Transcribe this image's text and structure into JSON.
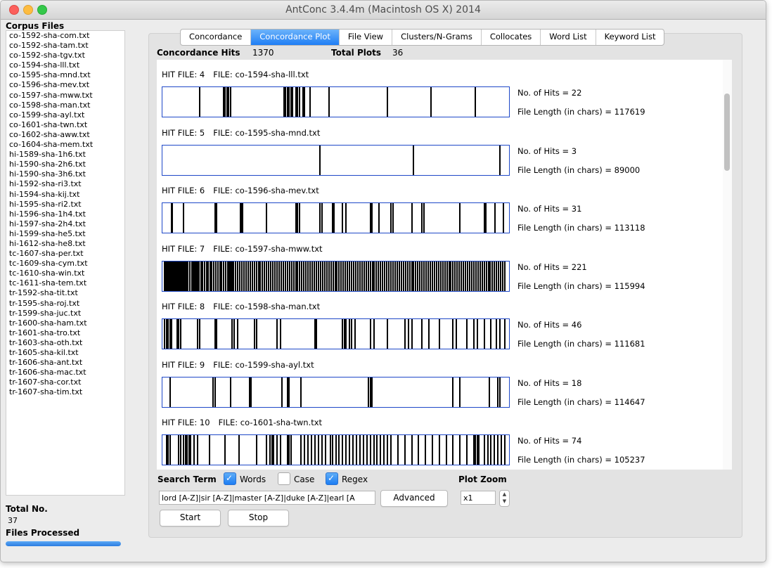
{
  "window": {
    "title": "AntConc 3.4.4m (Macintosh OS X) 2014"
  },
  "sidebar": {
    "title": "Corpus Files",
    "files": [
      "co-1592-sha-com.txt",
      "co-1592-sha-tam.txt",
      "co-1592-sha-tgv.txt",
      "co-1594-sha-lll.txt",
      "co-1595-sha-mnd.txt",
      "co-1596-sha-mev.txt",
      "co-1597-sha-mww.txt",
      "co-1598-sha-man.txt",
      "co-1599-sha-ayl.txt",
      "co-1601-sha-twn.txt",
      "co-1602-sha-aww.txt",
      "co-1604-sha-mem.txt",
      "hi-1589-sha-1h6.txt",
      "hi-1590-sha-2h6.txt",
      "hi-1590-sha-3h6.txt",
      "hi-1592-sha-ri3.txt",
      "hi-1594-sha-kij.txt",
      "hi-1595-sha-ri2.txt",
      "hi-1596-sha-1h4.txt",
      "hi-1597-sha-2h4.txt",
      "hi-1599-sha-he5.txt",
      "hi-1612-sha-he8.txt",
      "tc-1607-sha-per.txt",
      "tc-1609-sha-cym.txt",
      "tc-1610-sha-win.txt",
      "tc-1611-sha-tem.txt",
      "tr-1592-sha-tit.txt",
      "tr-1595-sha-roj.txt",
      "tr-1599-sha-juc.txt",
      "tr-1600-sha-ham.txt",
      "tr-1601-sha-tro.txt",
      "tr-1603-sha-oth.txt",
      "tr-1605-sha-kil.txt",
      "tr-1606-sha-ant.txt",
      "tr-1606-sha-mac.txt",
      "tr-1607-sha-cor.txt",
      "tr-1607-sha-tim.txt"
    ],
    "total_label": "Total No.",
    "total_value": "37",
    "processed_label": "Files Processed",
    "progress": 1.0
  },
  "tabs": [
    "Concordance",
    "Concordance Plot",
    "File View",
    "Clusters/N-Grams",
    "Collocates",
    "Word List",
    "Keyword List"
  ],
  "active_tab": 1,
  "summary": {
    "hits_label": "Concordance Hits",
    "hits_value": "1370",
    "plots_label": "Total Plots",
    "plots_value": "36"
  },
  "plots": [
    {
      "hit_file": "HIT FILE: 4",
      "file": "FILE: co-1594-sha-lll.txt",
      "hits_text": "No. of Hits = 22",
      "length_text": "File Length (in chars) = 117619",
      "hits": [
        0.105,
        0.175,
        0.18,
        0.185,
        0.19,
        0.195,
        0.35,
        0.355,
        0.36,
        0.365,
        0.37,
        0.375,
        0.385,
        0.39,
        0.395,
        0.405,
        0.41,
        0.425,
        0.48,
        0.65,
        0.775,
        0.905
      ]
    },
    {
      "hit_file": "HIT FILE: 5",
      "file": "FILE: co-1595-sha-mnd.txt",
      "hits_text": "No. of Hits = 3",
      "length_text": "File Length (in chars) = 89000",
      "hits": [
        0.455,
        0.725,
        0.975
      ]
    },
    {
      "hit_file": "HIT FILE: 6",
      "file": "FILE: co-1596-sha-mev.txt",
      "hits_text": "No. of Hits = 31",
      "length_text": "File Length (in chars) = 113118",
      "hits": [
        0.025,
        0.027,
        0.06,
        0.15,
        0.155,
        0.225,
        0.228,
        0.231,
        0.3,
        0.385,
        0.39,
        0.395,
        0.455,
        0.46,
        0.49,
        0.495,
        0.52,
        0.53,
        0.6,
        0.605,
        0.625,
        0.66,
        0.665,
        0.72,
        0.75,
        0.755,
        0.86,
        0.93,
        0.935,
        0.962,
        0.985
      ]
    },
    {
      "hit_file": "HIT FILE: 7",
      "file": "FILE: co-1597-sha-mww.txt",
      "hits_text": "No. of Hits = 221",
      "length_text": "File Length (in chars) = 115994",
      "hits": [
        0.004,
        0.008,
        0.012,
        0.016,
        0.02,
        0.024,
        0.028,
        0.032,
        0.036,
        0.04,
        0.044,
        0.048,
        0.052,
        0.056,
        0.06,
        0.064,
        0.068,
        0.072,
        0.078,
        0.083,
        0.088,
        0.092,
        0.096,
        0.1,
        0.104,
        0.11,
        0.115,
        0.12,
        0.126,
        0.13,
        0.136,
        0.14,
        0.146,
        0.152,
        0.158,
        0.164,
        0.17,
        0.176,
        0.182,
        0.188,
        0.192,
        0.196,
        0.2,
        0.204,
        0.21,
        0.216,
        0.222,
        0.228,
        0.234,
        0.24,
        0.246,
        0.252,
        0.258,
        0.264,
        0.27,
        0.276,
        0.282,
        0.288,
        0.294,
        0.3,
        0.306,
        0.312,
        0.318,
        0.324,
        0.33,
        0.336,
        0.342,
        0.348,
        0.354,
        0.36,
        0.366,
        0.372,
        0.378,
        0.384,
        0.39,
        0.396,
        0.402,
        0.408,
        0.414,
        0.42,
        0.426,
        0.432,
        0.438,
        0.444,
        0.45,
        0.456,
        0.462,
        0.468,
        0.474,
        0.48,
        0.486,
        0.492,
        0.498,
        0.504,
        0.51,
        0.516,
        0.522,
        0.528,
        0.534,
        0.54,
        0.546,
        0.552,
        0.558,
        0.564,
        0.57,
        0.576,
        0.582,
        0.588,
        0.594,
        0.6,
        0.606,
        0.612,
        0.618,
        0.624,
        0.63,
        0.636,
        0.642,
        0.648,
        0.654,
        0.66,
        0.666,
        0.672,
        0.678,
        0.684,
        0.69,
        0.696,
        0.702,
        0.708,
        0.714,
        0.72,
        0.726,
        0.732,
        0.738,
        0.744,
        0.75,
        0.756,
        0.762,
        0.768,
        0.774,
        0.78,
        0.786,
        0.792,
        0.798,
        0.804,
        0.81,
        0.816,
        0.822,
        0.828,
        0.834,
        0.84,
        0.846,
        0.852,
        0.858,
        0.864,
        0.87,
        0.876,
        0.882,
        0.888,
        0.894,
        0.9,
        0.906,
        0.912,
        0.918,
        0.924,
        0.93,
        0.936,
        0.942,
        0.948,
        0.954,
        0.96,
        0.966,
        0.972,
        0.978,
        0.984,
        0.99
      ]
    },
    {
      "hit_file": "HIT FILE: 8",
      "file": "FILE: co-1598-sha-man.txt",
      "hits_text": "No. of Hits = 46",
      "length_text": "File Length (in chars) = 111681",
      "hits": [
        0.005,
        0.01,
        0.015,
        0.02,
        0.025,
        0.04,
        0.045,
        0.05,
        0.1,
        0.105,
        0.15,
        0.155,
        0.2,
        0.205,
        0.215,
        0.265,
        0.27,
        0.33,
        0.34,
        0.44,
        0.445,
        0.52,
        0.525,
        0.53,
        0.54,
        0.545,
        0.555,
        0.6,
        0.61,
        0.65,
        0.7,
        0.71,
        0.72,
        0.75,
        0.77,
        0.8,
        0.84,
        0.85,
        0.88,
        0.9,
        0.91,
        0.93,
        0.95,
        0.965,
        0.975,
        0.99
      ]
    },
    {
      "hit_file": "HIT FILE: 9",
      "file": "FILE: co-1599-sha-ayl.txt",
      "hits_text": "No. of Hits = 18",
      "length_text": "File Length (in chars) = 114647",
      "hits": [
        0.02,
        0.145,
        0.15,
        0.195,
        0.25,
        0.255,
        0.345,
        0.36,
        0.365,
        0.4,
        0.595,
        0.6,
        0.605,
        0.84,
        0.86,
        0.945,
        0.97,
        0.975
      ]
    },
    {
      "hit_file": "HIT FILE: 10",
      "file": "FILE: co-1601-sha-twn.txt",
      "hits_text": "No. of Hits = 74",
      "length_text": "File Length (in chars) = 105237",
      "hits": [
        0.01,
        0.015,
        0.02,
        0.045,
        0.05,
        0.06,
        0.065,
        0.07,
        0.075,
        0.08,
        0.09,
        0.1,
        0.135,
        0.18,
        0.22,
        0.27,
        0.3,
        0.31,
        0.315,
        0.32,
        0.33,
        0.34,
        0.36,
        0.365,
        0.37,
        0.4,
        0.41,
        0.42,
        0.43,
        0.44,
        0.45,
        0.46,
        0.47,
        0.485,
        0.49,
        0.5,
        0.51,
        0.52,
        0.53,
        0.54,
        0.55,
        0.56,
        0.57,
        0.58,
        0.59,
        0.6,
        0.61,
        0.62,
        0.63,
        0.64,
        0.65,
        0.66,
        0.68,
        0.7,
        0.72,
        0.74,
        0.76,
        0.78,
        0.8,
        0.82,
        0.84,
        0.86,
        0.88,
        0.9,
        0.905,
        0.91,
        0.915,
        0.93,
        0.94,
        0.95,
        0.96,
        0.97,
        0.98,
        0.99
      ]
    }
  ],
  "controls": {
    "search_term_label": "Search Term",
    "words_label": "Words",
    "words_checked": true,
    "case_label": "Case",
    "case_checked": false,
    "regex_label": "Regex",
    "regex_checked": true,
    "plot_zoom_label": "Plot Zoom",
    "search_value": "lord [A-Z]|sir [A-Z]|master [A-Z]|duke [A-Z]|earl [A",
    "advanced_label": "Advanced",
    "zoom_value": "x1",
    "start_label": "Start",
    "stop_label": "Stop"
  }
}
